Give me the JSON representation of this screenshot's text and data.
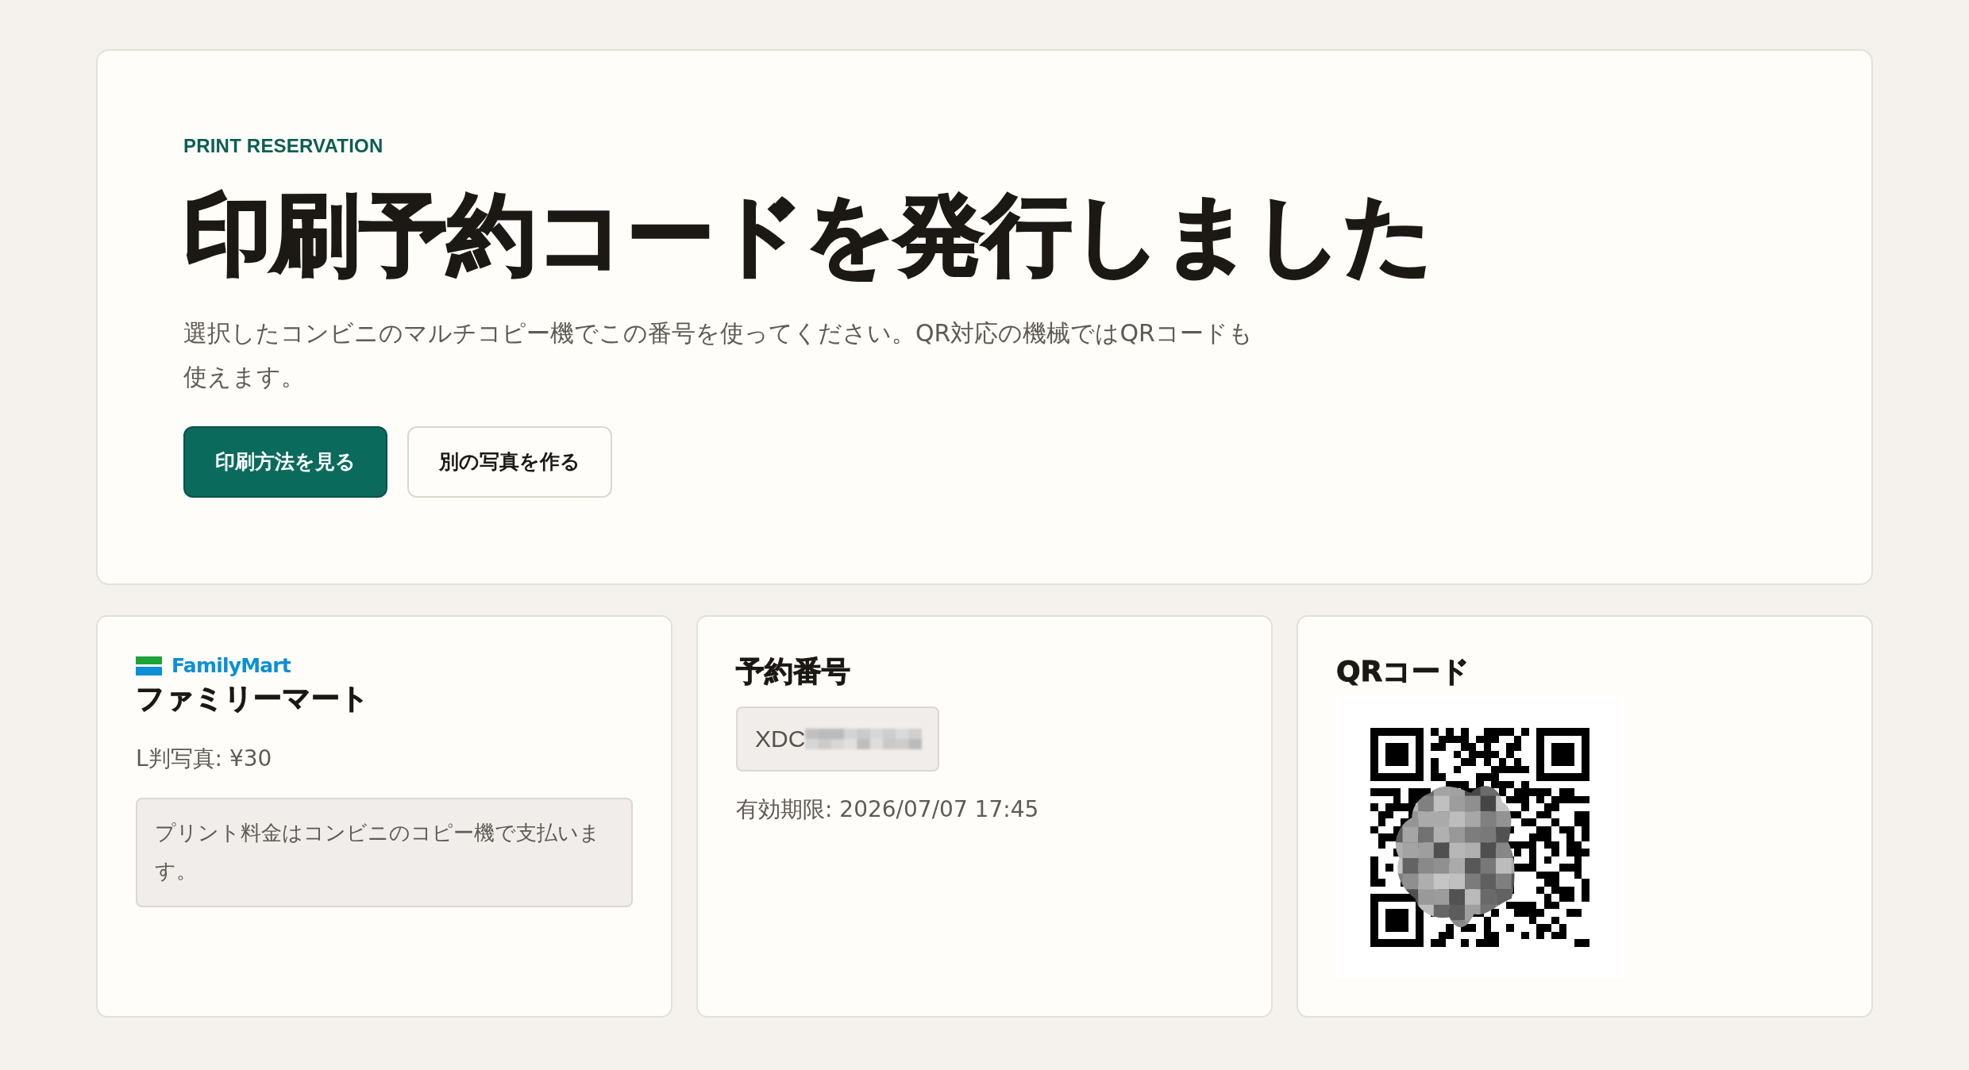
{
  "header": {
    "eyebrow": "PRINT RESERVATION",
    "title": "印刷予約コードを発行しました",
    "description": "選択したコンビニのマルチコピー機でこの番号を使ってください。QR対応の機械ではQRコードも使えます。",
    "buttons": [
      {
        "label": "印刷方法を見る",
        "kind": "primary"
      },
      {
        "label": "別の写真を作る",
        "kind": "secondary"
      }
    ]
  },
  "cards": [
    {
      "kind": "store",
      "logo_text": "FamilyMart",
      "title": "ファミリーマート",
      "price": "L判写真: ¥30",
      "note": "プリント料金はコンビニのコピー機で支払います。"
    },
    {
      "kind": "code",
      "title": "予約番号",
      "code": "XDC",
      "expiry": "有効期限: 2026/07/07 17:45"
    },
    {
      "kind": "qr",
      "title": "QRコード"
    }
  ]
}
